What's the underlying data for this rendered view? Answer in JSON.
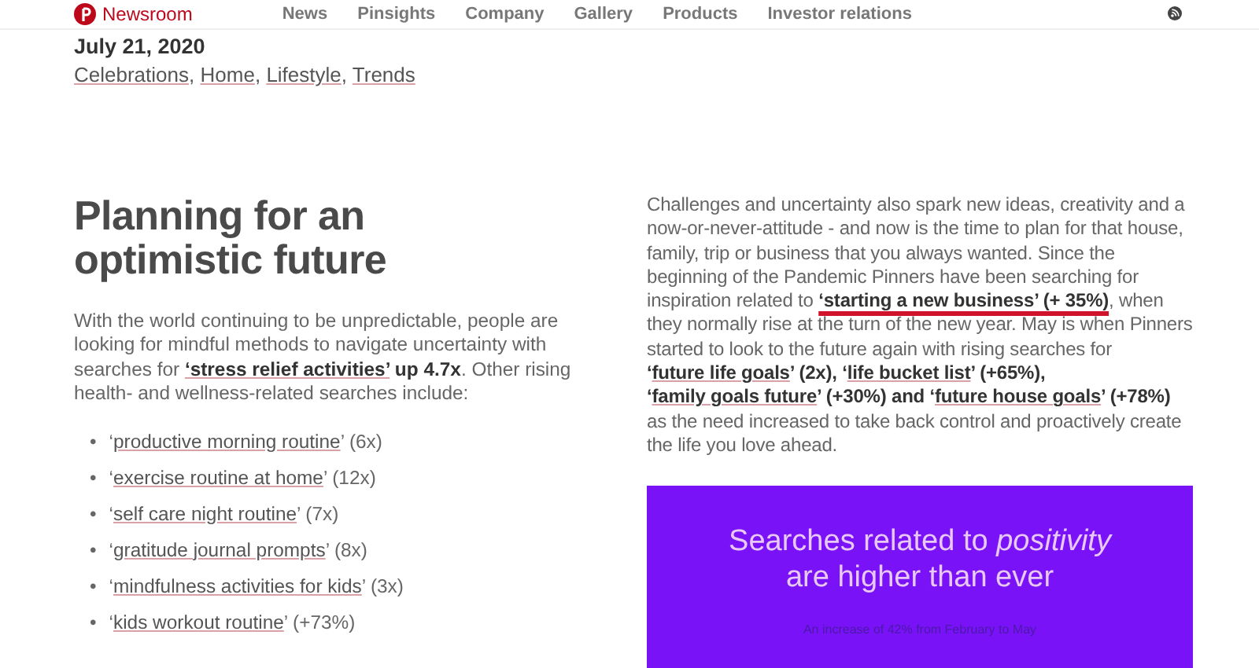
{
  "nav": {
    "brand": "Newsroom",
    "links": [
      "News",
      "Pinsights",
      "Company",
      "Gallery",
      "Products",
      "Investor relations"
    ]
  },
  "article": {
    "date": "July 21, 2020",
    "tags": [
      {
        "label": "Celebrations",
        "separator": ","
      },
      {
        "label": "Home",
        "separator": ","
      },
      {
        "label": "Lifestyle",
        "separator": ","
      },
      {
        "label": "Trends"
      }
    ],
    "title": "Planning for an optimistic future",
    "intro": [
      {
        "kind": "plain",
        "text": "With the world continuing to be unpredictable, people are looking for mindful methods to navigate uncertainty with searches for "
      },
      {
        "kind": "link",
        "text": "‘stress relief activities’"
      },
      {
        "kind": "bold",
        "text": " up 4.7x"
      },
      {
        "kind": "plain",
        "text": ". Other rising health- and wellness-related searches include:"
      }
    ],
    "searches": [
      {
        "bullet": "•",
        "before": "‘",
        "link": "productive morning routine",
        "after": "’ (6x)"
      },
      {
        "bullet": "•",
        "before": "‘",
        "link": "exercise routine at home",
        "after": "’ (12x)"
      },
      {
        "bullet": "•",
        "before": "‘",
        "link": "self care night routine",
        "after": "’ (7x)"
      },
      {
        "bullet": "•",
        "before": "‘",
        "link": "gratitude journal prompts",
        "after": "’ (8x)"
      },
      {
        "bullet": "•",
        "before": "‘",
        "link": "mindfulness activities for kids",
        "after": "’ (3x)"
      },
      {
        "bullet": "•",
        "before": "‘",
        "link": "kids workout routine",
        "after": "’ (+73%)"
      }
    ],
    "body": [
      {
        "kind": "plain",
        "text": "Challenges and uncertainty also spark new ideas, creativity and a now-or-never-attitude - and now is the time to plan for that house, family, trip or business that you always wanted. Since the beginning of the Pandemic Pinners have been searching for inspiration related to "
      },
      {
        "kind": "highlight",
        "text": "‘starting a new business’ (+ 35%)"
      },
      {
        "kind": "plain",
        "text": ", when they normally rise at the turn of the new year. May is when Pinners started to look to the future again with rising searches for "
      },
      {
        "kind": "bold",
        "text": "‘"
      },
      {
        "kind": "link",
        "text": "future life goals"
      },
      {
        "kind": "bold",
        "text": "’ (2x), ‘"
      },
      {
        "kind": "link",
        "text": "life bucket list"
      },
      {
        "kind": "bold",
        "text": "’ (+65%), ‘"
      },
      {
        "kind": "link",
        "text": "family goals future"
      },
      {
        "kind": "bold",
        "text": "’ (+30%) and ‘"
      },
      {
        "kind": "link",
        "text": "future house goals"
      },
      {
        "kind": "bold",
        "text": "’ (+78%)"
      },
      {
        "kind": "plain",
        "text": " as the need increased to take back control and proactively create the life you love ahead."
      }
    ],
    "graphic": {
      "headline": "Searches related to *positivity* are higher than ever",
      "subtitle": "An increase of 42% from February to May"
    }
  }
}
